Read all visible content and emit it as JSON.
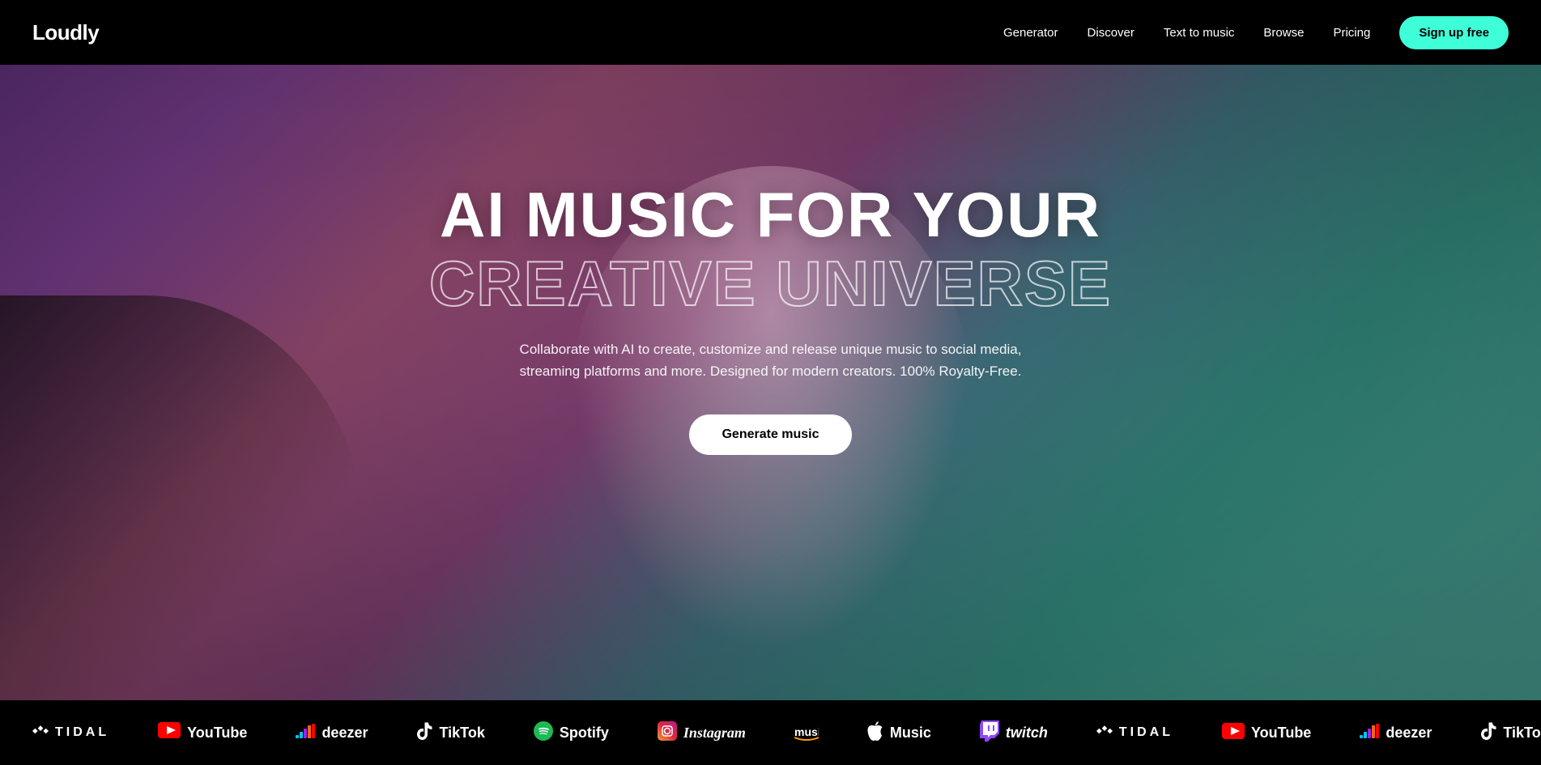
{
  "nav": {
    "logo": "Loudly",
    "links": [
      {
        "label": "Generator",
        "name": "generator"
      },
      {
        "label": "Discover",
        "name": "discover"
      },
      {
        "label": "Text to music",
        "name": "text-to-music"
      },
      {
        "label": "Browse",
        "name": "browse"
      },
      {
        "label": "Pricing",
        "name": "pricing"
      }
    ],
    "signup_label": "Sign up free"
  },
  "hero": {
    "title_line1": "AI MUSIC FOR YOUR",
    "title_line2": "CREATIVE UNIVERSE",
    "subtitle": "Collaborate with AI to create, customize and release unique music to social media, streaming platforms and more. Designed for modern creators. 100% Royalty-Free.",
    "cta_label": "Generate music"
  },
  "logos": {
    "items": [
      {
        "name": "tidal",
        "label": "TIDAL",
        "type": "tidal"
      },
      {
        "name": "youtube",
        "label": "YouTube",
        "type": "youtube"
      },
      {
        "name": "deezer",
        "label": "deezer",
        "type": "deezer"
      },
      {
        "name": "tiktok",
        "label": "TikTok",
        "type": "tiktok"
      },
      {
        "name": "spotify",
        "label": "Spotify",
        "type": "spotify"
      },
      {
        "name": "instagram",
        "label": "Instagram",
        "type": "instagram"
      },
      {
        "name": "amazon-music",
        "label": "music",
        "type": "amazon"
      },
      {
        "name": "apple-music",
        "label": "Music",
        "type": "apple"
      },
      {
        "name": "twitch",
        "label": "twitch",
        "type": "twitch"
      },
      {
        "name": "tidal2",
        "label": "TIDAL",
        "type": "tidal"
      },
      {
        "name": "youtube2",
        "label": "YouTube",
        "type": "youtube"
      },
      {
        "name": "deezer2",
        "label": "deezer",
        "type": "deezer"
      },
      {
        "name": "tiktok2",
        "label": "TikTok",
        "type": "tiktok"
      }
    ]
  }
}
